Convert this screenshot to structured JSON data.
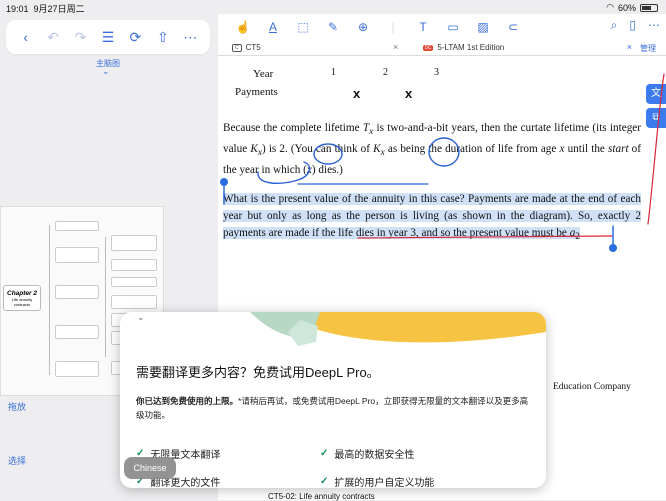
{
  "status": {
    "time": "19:01",
    "date": "9月27日周二",
    "battery": "60%"
  },
  "left": {
    "mindmap_label": "主脑图",
    "root_title": "Chapter 2",
    "root_subtitle": "Life annuity contracts",
    "side_buttons": [
      "拖放",
      "选择"
    ]
  },
  "toolbar": {
    "tools": [
      "pointer-icon",
      "text-highlight-icon",
      "rectangle-icon",
      "pen-icon",
      "stamp-icon",
      "textbox-icon",
      "note-icon",
      "image-icon",
      "link-icon"
    ]
  },
  "tabs": {
    "tab1_badge": "C",
    "tab1_label": "CT5",
    "tab2_badge": "5C",
    "tab2_label": "5-LTAM 1st Edition",
    "manage": "管理"
  },
  "doc": {
    "year_label": "Year",
    "payments_label": "Payments",
    "years": [
      "1",
      "2",
      "3"
    ],
    "payment_marks": [
      "x",
      "x"
    ],
    "para1_a": "Because the complete lifetime ",
    "para1_b": "T",
    "para1_c": "x",
    "para1_d": " is two-and-a-bit years, then the curtate lifetime (its integer value ",
    "para1_e": "K",
    "para1_f": "x",
    "para1_g": ") is 2.  (You can think of ",
    "para1_h": " as being the duration of life from age ",
    "para1_i": "x",
    "para1_j": " until the ",
    "para1_k": "start",
    "para1_l": " of the year in which (",
    "para1_m": ") dies.)",
    "para2": "What is the present value of the annuity in this case?  Payments are made at the end of each year but only as long as the person is living (as shown in the diagram).  So, exactly 2 payments are made if the life dies in year 3, and so the present value must be ",
    "para2_a": "a",
    "para2_sub": "2",
    "publisher": "Education Company",
    "footer": "CT5-02: Life annuity contracts"
  },
  "deepl": {
    "title": "需要翻译更多内容？免费试用DeepL Pro。",
    "sub_bold": "你已达到免费使用的上限。",
    "sub_rest": "*请稍后再试，或免费试用DeepL Pro，立即获得无限量的文本翻译以及更多高级功能。",
    "features": [
      "无限量文本翻译",
      "最高的数据安全性",
      "翻译更大的文件",
      "扩展的用户自定义功能"
    ],
    "lang_chip": "Chinese"
  },
  "colors": {
    "accent": "#3b6fd8",
    "highlight": "#cfe0f7",
    "ink_blue": "#2a5fd6",
    "ink_red": "#d8263a"
  }
}
